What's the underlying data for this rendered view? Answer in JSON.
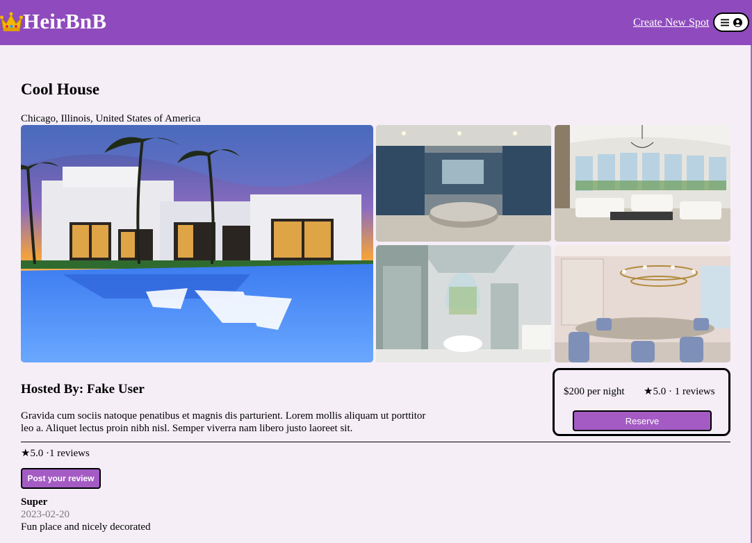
{
  "header": {
    "brand": "HeirBnB",
    "create_link": "Create New Spot",
    "bar_color": "#8f4bbd"
  },
  "spot": {
    "title": "Cool House",
    "location": "Chicago, Illinois, United States of America",
    "hosted_by": "Hosted By: Fake User",
    "description": "Gravida cum sociis natoque penatibus et magnis dis parturient. Lorem mollis aliquam ut porttitor leo a. Aliquet lectus proin nibh nisl. Semper viverra nam libero justo laoreet sit.",
    "images": [
      "mansion exterior with pool at sunset",
      "kitchen with dark blue cabinets",
      "white living room with large windows",
      "bathroom with freestanding tub",
      "dining room with oval table"
    ]
  },
  "booking": {
    "price": "$200 per night",
    "stats": "★5.0 · 1 reviews",
    "reserve_label": "Reserve"
  },
  "reviews": {
    "summary": "★5.0 ·1 reviews",
    "post_label": "Post your review",
    "items": [
      {
        "author": "Super",
        "date": "2023-02-20",
        "text": "Fun place and nicely decorated"
      }
    ]
  },
  "colors": {
    "accent": "#8f4bbd",
    "button": "#a45cc4",
    "background": "#f5eef7"
  }
}
